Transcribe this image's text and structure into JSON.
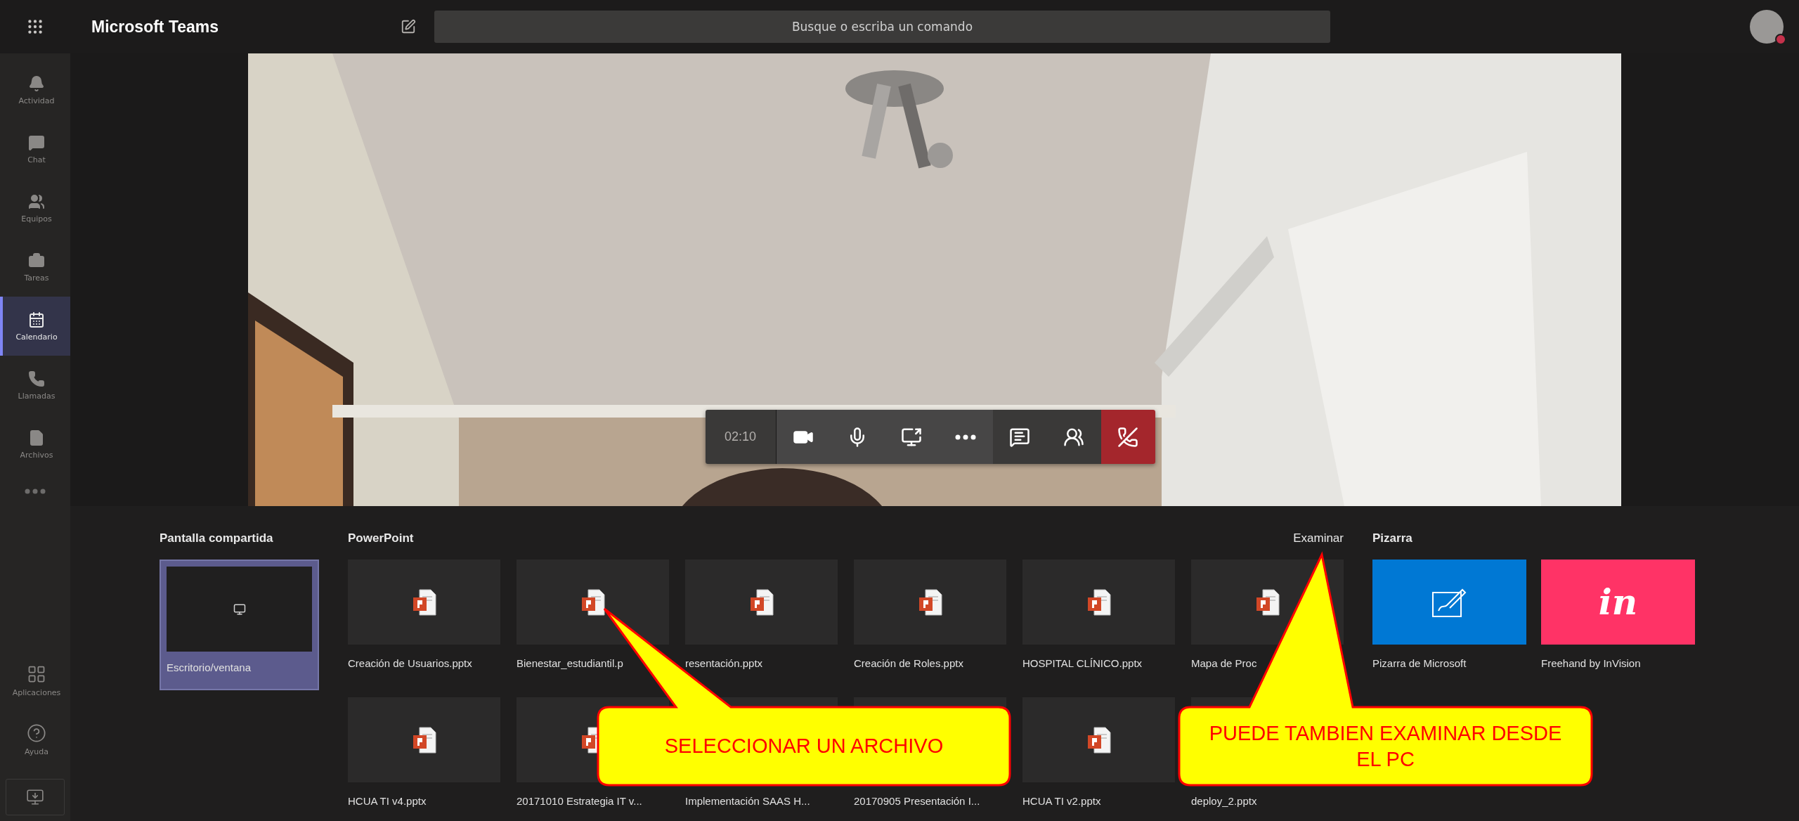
{
  "top_bar": {
    "app_title": "Microsoft Teams",
    "search": {
      "placeholder": "Busque o escriba un comando"
    }
  },
  "rail": {
    "items": [
      {
        "kind": "activity",
        "label": "Actividad",
        "selected": false
      },
      {
        "kind": "chat",
        "label": "Chat",
        "selected": false
      },
      {
        "kind": "teams",
        "label": "Equipos",
        "selected": false
      },
      {
        "kind": "tasks",
        "label": "Tareas",
        "selected": false
      },
      {
        "kind": "calendar",
        "label": "Calendario",
        "selected": true
      },
      {
        "kind": "calls",
        "label": "Llamadas",
        "selected": false
      },
      {
        "kind": "files",
        "label": "Archivos",
        "selected": false
      }
    ],
    "bottom_items": [
      {
        "kind": "apps",
        "label": "Aplicaciones"
      },
      {
        "kind": "help",
        "label": "Ayuda"
      }
    ]
  },
  "call_controls": {
    "timer": "02:10",
    "buttons": [
      {
        "kind": "camera"
      },
      {
        "kind": "mic"
      },
      {
        "kind": "share"
      },
      {
        "kind": "more"
      },
      {
        "kind": "chat"
      },
      {
        "kind": "people"
      },
      {
        "kind": "hangup"
      }
    ]
  },
  "share_tray": {
    "desktop": {
      "heading": "Pantalla compartida",
      "tiles": [
        {
          "label": "Escritorio/ventana",
          "selected": true
        }
      ]
    },
    "powerpoint": {
      "heading": "PowerPoint",
      "browse": "Examinar",
      "files": [
        {
          "label": "Creación de Usuarios.pptx"
        },
        {
          "label": "Bienestar_estudiantil.p"
        },
        {
          "label": "resentación.pptx"
        },
        {
          "label": "Creación de Roles.pptx"
        },
        {
          "label": "HOSPITAL CLÍNICO.pptx"
        },
        {
          "label": "Mapa de Proc"
        },
        {
          "label": "HCUA TI v4.pptx"
        },
        {
          "label": "20171010 Estrategia IT v..."
        },
        {
          "label": "Implementación SAAS H..."
        },
        {
          "label": "20170905 Presentación I..."
        },
        {
          "label": "HCUA TI v2.pptx"
        },
        {
          "label": "deploy_2.pptx"
        }
      ]
    },
    "whiteboard": {
      "heading": "Pizarra",
      "apps": [
        {
          "kind": "microsoft",
          "label": "Pizarra de Microsoft"
        },
        {
          "kind": "invision",
          "label": "Freehand by InVision",
          "logo": "in"
        }
      ]
    }
  },
  "callouts": [
    {
      "text": "SELECCIONAR UN ARCHIVO"
    },
    {
      "text": "PUEDE TAMBIEN EXAMINAR DESDE EL PC"
    }
  ]
}
